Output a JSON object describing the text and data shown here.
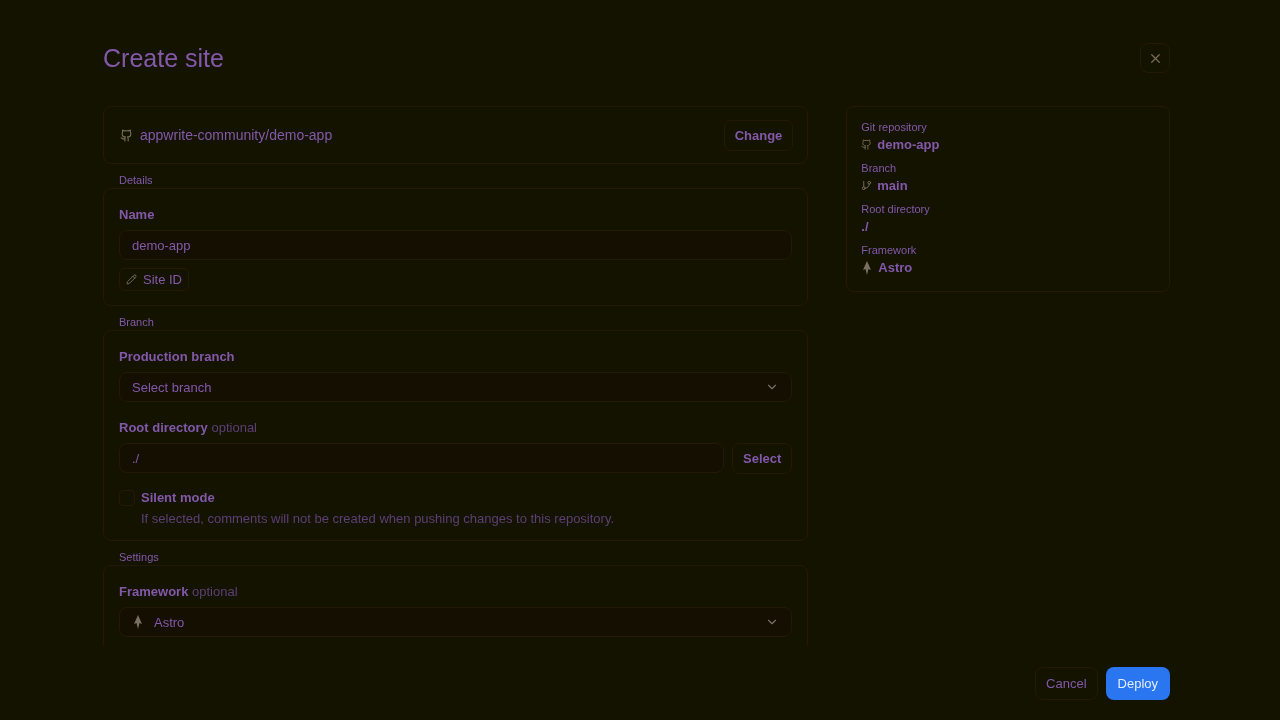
{
  "title": "Create site",
  "repository": {
    "name": "appwrite-community/demo-app",
    "action": "Change"
  },
  "details": {
    "heading": "Details",
    "name_label": "Name",
    "name_value": "demo-app",
    "site_id": "Site ID"
  },
  "branch": {
    "heading": "Branch",
    "production_label": "Production branch",
    "production_placeholder": "Select branch",
    "root_label": "Root directory",
    "root_hint": "optional",
    "root_value": "./",
    "root_action": "Select",
    "silent_label": "Silent mode",
    "silent_checked": false,
    "silent_description": "If selected, comments will not be created when pushing changes to this repository."
  },
  "settings": {
    "heading": "Settings",
    "framework_label": "Framework",
    "framework_hint": "optional",
    "framework_value": "Astro"
  },
  "summary": [
    {
      "kind": "repo",
      "label": "Git repository",
      "value": "demo-app"
    },
    {
      "kind": "branch",
      "label": "Branch",
      "value": "main"
    },
    {
      "kind": "plain",
      "label": "Root directory",
      "value": "./"
    },
    {
      "kind": "framework",
      "label": "Framework",
      "value": "Astro"
    }
  ],
  "footer": {
    "cancel": "Cancel",
    "deploy": "Deploy"
  }
}
